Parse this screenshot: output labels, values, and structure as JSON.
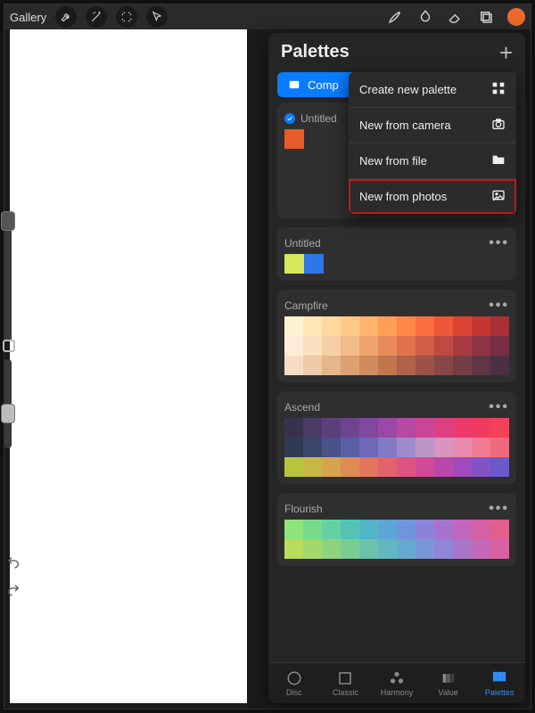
{
  "topbar": {
    "gallery_label": "Gallery",
    "current_color": "#ea6a2d"
  },
  "panel": {
    "title": "Palettes",
    "default_button_label": "Comp"
  },
  "dropdown": {
    "items": [
      {
        "label": "Create new palette",
        "icon": "grid-icon"
      },
      {
        "label": "New from camera",
        "icon": "camera-icon"
      },
      {
        "label": "New from file",
        "icon": "folder-icon"
      },
      {
        "label": "New from photos",
        "icon": "photo-icon",
        "highlight": true
      }
    ]
  },
  "palettes": [
    {
      "name": "Untitled",
      "checked": true,
      "rows": [
        [
          "#e85a27"
        ]
      ]
    },
    {
      "name": "Untitled",
      "rows": [
        [
          "#d6e85a",
          "#2f76e8"
        ]
      ]
    },
    {
      "name": "Campfire",
      "rows": [
        [
          "#fff2d0",
          "#ffe7b8",
          "#ffd99d",
          "#ffc985",
          "#ffb56c",
          "#ff9e57",
          "#ff8747",
          "#f96f3d",
          "#ee5836",
          "#db4433",
          "#c53633",
          "#a83036"
        ],
        [
          "#fdedd6",
          "#fbe0c0",
          "#f7cfa5",
          "#f3bb88",
          "#eea46f",
          "#e88c5b",
          "#df734d",
          "#d25c45",
          "#c04942",
          "#a93c42",
          "#903444",
          "#772e45"
        ],
        [
          "#f5dcc4",
          "#eecaa8",
          "#e5b68b",
          "#dba171",
          "#cf8b5d",
          "#c17650",
          "#b1624a",
          "#9e5247",
          "#894646",
          "#743d46",
          "#5f3645",
          "#4b3043"
        ]
      ]
    },
    {
      "name": "Ascend",
      "rows": [
        [
          "#39324f",
          "#4a3a66",
          "#5c407c",
          "#6c4490",
          "#80489f",
          "#9a4aa6",
          "#b44aa3",
          "#cb4595",
          "#de3f83",
          "#ea3a70",
          "#f03a62",
          "#f24158"
        ],
        [
          "#2e3a52",
          "#3b466d",
          "#4a5288",
          "#5a5ea2",
          "#6d68b8",
          "#837ac5",
          "#9f8acb",
          "#bd95c9",
          "#d795bf",
          "#e78cac",
          "#ef7b93",
          "#f1697c"
        ],
        [
          "#b9c43e",
          "#c8b846",
          "#d5a44d",
          "#de8c54",
          "#e3775e",
          "#e3636d",
          "#dd5481",
          "#d04a97",
          "#bb47ab",
          "#a04abb",
          "#8352c5",
          "#685ac8"
        ]
      ]
    },
    {
      "name": "Flourish",
      "rows": [
        [
          "#8fe37b",
          "#77db8d",
          "#63d1a2",
          "#55c4b7",
          "#52b6c9",
          "#5ca6d6",
          "#7194dc",
          "#8c82da",
          "#a873cf",
          "#c167bd",
          "#d460a5",
          "#e05f8c"
        ],
        [
          "#b9dc5c",
          "#a3d96a",
          "#8dd47d",
          "#79cd93",
          "#6ac3aa",
          "#63b7bf",
          "#67a8cf",
          "#7897d7",
          "#9085d6",
          "#ab75cc",
          "#c469ba",
          "#d761a3"
        ]
      ]
    }
  ],
  "tabs": [
    {
      "label": "Disc"
    },
    {
      "label": "Classic"
    },
    {
      "label": "Harmony"
    },
    {
      "label": "Value"
    },
    {
      "label": "Palettes",
      "active": true
    }
  ]
}
